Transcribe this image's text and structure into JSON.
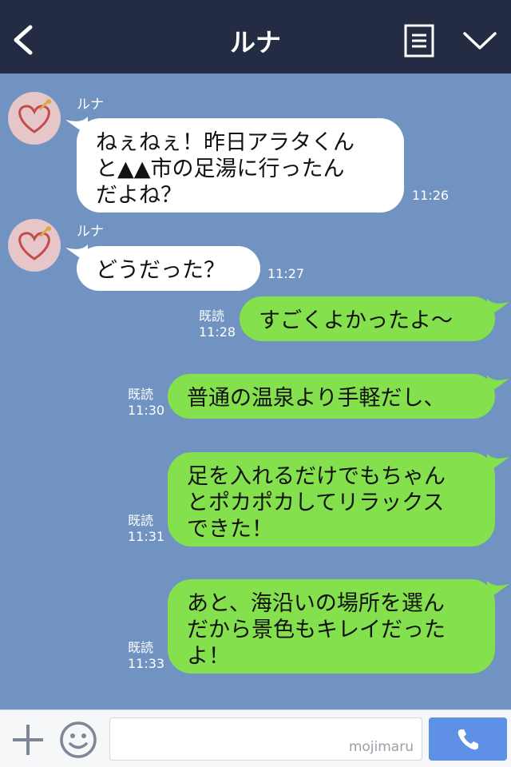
{
  "header": {
    "title": "ルナ"
  },
  "messages": [
    {
      "direction": "in",
      "sender": "ルナ",
      "text": "ねぇねぇ！昨日アラタくん\nと▲▲市の足湯に行ったん\nだよね？",
      "time": "11:26"
    },
    {
      "direction": "in",
      "sender": "ルナ",
      "text": "どうだった？",
      "time": "11:27"
    },
    {
      "direction": "out",
      "read": "既読",
      "text": "すごくよかったよ〜",
      "time": "11:28"
    },
    {
      "direction": "out",
      "read": "既読",
      "text": "普通の温泉より手軽だし、",
      "time": "11:30"
    },
    {
      "direction": "out",
      "read": "既読",
      "text": "足を入れるだけでもちゃん\nとポカポカしてリラックス\nできた！",
      "time": "11:31"
    },
    {
      "direction": "out",
      "read": "既読",
      "text": "あと、海沿いの場所を選ん\nだから景色もキレイだった\nよ！",
      "time": "11:33"
    }
  ],
  "footer": {
    "watermark": "mojimaru"
  },
  "colors": {
    "header_bg": "#242c44",
    "chat_bg": "#7193c2",
    "bubble_in": "#ffffff",
    "bubble_out": "#84e04c",
    "call_button": "#5e91e6"
  },
  "icons": [
    "back-icon",
    "menu-icon",
    "chevron-down-icon",
    "plus-icon",
    "emoji-icon",
    "phone-icon"
  ]
}
